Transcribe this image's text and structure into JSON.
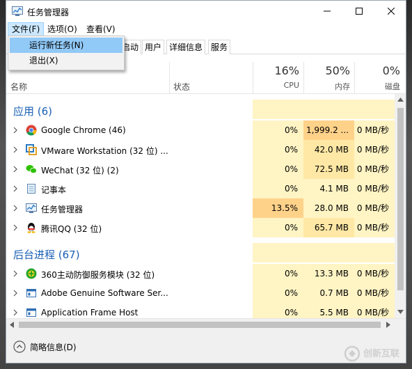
{
  "window": {
    "title": "任务管理器"
  },
  "menu": {
    "file": "文件(F)",
    "options": "选项(O)",
    "view": "查看(V)"
  },
  "file_menu": {
    "run_new_task": "运行新任务(N)",
    "exit": "退出(X)"
  },
  "tabs": {
    "t1": "启动",
    "t2": "用户",
    "t3": "详细信息",
    "t4": "服务"
  },
  "columns": {
    "name": "名称",
    "status": "状态",
    "cpu_pct": "16%",
    "cpu": "CPU",
    "mem_pct": "50%",
    "mem": "内存",
    "disk_pct": "0%",
    "disk": "磁盘"
  },
  "groups": {
    "apps": "应用 (6)",
    "background": "后台进程 (67)"
  },
  "apps": [
    {
      "name": "Google Chrome (46)",
      "cpu": "0%",
      "mem": "1,999.2 ...",
      "disk": "0 MB/秒",
      "icon": "chrome-icon"
    },
    {
      "name": "VMware Workstation (32 位) ...",
      "cpu": "0%",
      "mem": "42.0 MB",
      "disk": "0 MB/秒",
      "icon": "vmware-icon"
    },
    {
      "name": "WeChat (32 位) (2)",
      "cpu": "0%",
      "mem": "72.5 MB",
      "disk": "0 MB/秒",
      "icon": "wechat-icon"
    },
    {
      "name": "记事本",
      "cpu": "0%",
      "mem": "4.1 MB",
      "disk": "0 MB/秒",
      "icon": "notepad-icon"
    },
    {
      "name": "任务管理器",
      "cpu": "13.5%",
      "mem": "28.0 MB",
      "disk": "0 MB/秒",
      "icon": "task-manager-icon"
    },
    {
      "name": "腾讯QQ (32 位)",
      "cpu": "0%",
      "mem": "65.7 MB",
      "disk": "0 MB/秒",
      "icon": "qq-icon"
    }
  ],
  "background": [
    {
      "name": "360主动防御服务模块 (32 位)",
      "cpu": "0%",
      "mem": "13.3 MB",
      "disk": "0 MB/秒",
      "icon": "360-icon"
    },
    {
      "name": "Adobe Genuine Software Ser...",
      "cpu": "0%",
      "mem": "0.7 MB",
      "disk": "0 MB/秒",
      "icon": "app-window-icon"
    },
    {
      "name": "Application Frame Host",
      "cpu": "0%",
      "mem": "5.5 MB",
      "disk": "0 MB/秒",
      "icon": "app-window-icon"
    }
  ],
  "footer": {
    "fewer_details": "简略信息(D)"
  },
  "watermark": {
    "text": "创新互联"
  },
  "colors": {
    "accent": "#1a5fb4",
    "menu_highlight": "#91c9f7",
    "heat_low": "#fff4c4",
    "heat_mid": "#ffe8a5",
    "heat_high": "#ffd28a"
  }
}
